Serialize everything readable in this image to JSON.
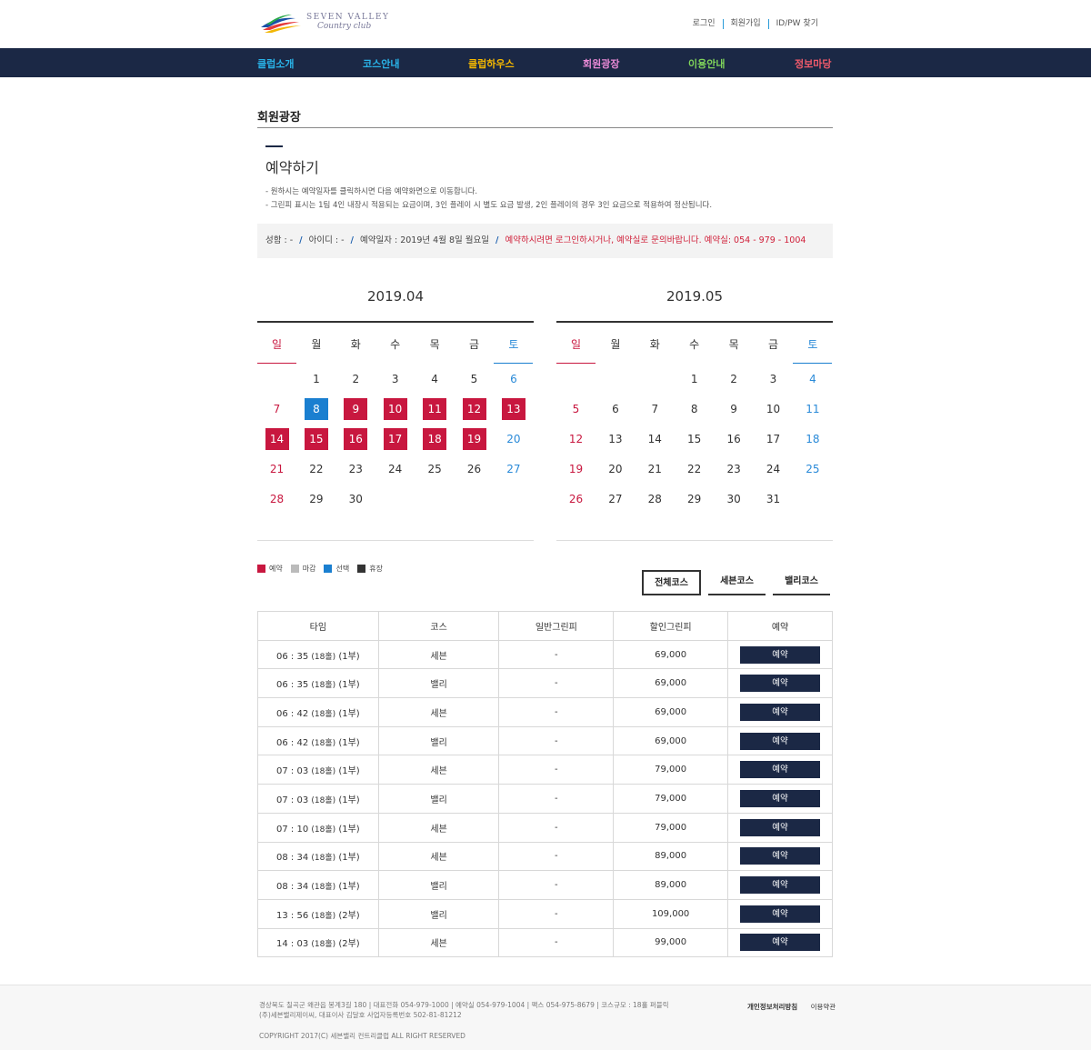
{
  "header": {
    "logo_line1": "SEVEN VALLEY",
    "logo_line2": "Country club",
    "top_links": [
      "로그인",
      "회원가입",
      "ID/PW 찾기"
    ]
  },
  "nav": [
    {
      "label": "클럽소개",
      "color": "#29b3e8"
    },
    {
      "label": "코스안내",
      "color": "#29b3e8"
    },
    {
      "label": "클럽하우스",
      "color": "#f5b800"
    },
    {
      "label": "회원광장",
      "color": "#e98ad6"
    },
    {
      "label": "이용안내",
      "color": "#7fd35a"
    },
    {
      "label": "정보마당",
      "color": "#f05a6b"
    }
  ],
  "page_title": "회원광장",
  "section_title": "예약하기",
  "notes": [
    "- 원하시는 예약일자를 클릭하시면 다음 예약화면으로 이동합니다.",
    "- 그린피 표시는 1팀 4인 내장시 적용되는 요금이며, 3인 플레이 시 별도 요금 발생, 2인 플레이의 경우 3인 요금으로 적용하여 정산됩니다."
  ],
  "info": {
    "name": "성함 : -",
    "id": "아이디 : -",
    "date": "예약일자 : 2019년 4월 8일 월요일",
    "separator": "/",
    "warning": "예약하시려면 로그인하시거나, 예약실로 문의바랍니다. 예약실: 054 - 979 - 1004"
  },
  "weekdays": [
    "일",
    "월",
    "화",
    "수",
    "목",
    "금",
    "토"
  ],
  "calendars": [
    {
      "title": "2019.04",
      "first_weekday": 1,
      "days": 30,
      "reservable": [
        9,
        10,
        11,
        12,
        13,
        14,
        15,
        16,
        17,
        18,
        19
      ],
      "selected": [
        8
      ]
    },
    {
      "title": "2019.05",
      "first_weekday": 3,
      "days": 31,
      "reservable": [],
      "selected": []
    }
  ],
  "legend": [
    {
      "label": "예약",
      "color": "#c8173f"
    },
    {
      "label": "마감",
      "color": "#bbbbbb"
    },
    {
      "label": "선택",
      "color": "#1a7fd0"
    },
    {
      "label": "휴장",
      "color": "#333333"
    }
  ],
  "course_tabs": [
    "전체코스",
    "세븐코스",
    "밸리코스"
  ],
  "table": {
    "headers": [
      "타임",
      "코스",
      "일반그린피",
      "할인그린피",
      "예약"
    ],
    "button_label": "예약",
    "rows": [
      {
        "time": "06 : 35",
        "holes": "(18홀)",
        "part": "(1부)",
        "course": "세븐",
        "normal": "-",
        "discount": "69,000"
      },
      {
        "time": "06 : 35",
        "holes": "(18홀)",
        "part": "(1부)",
        "course": "밸리",
        "normal": "-",
        "discount": "69,000"
      },
      {
        "time": "06 : 42",
        "holes": "(18홀)",
        "part": "(1부)",
        "course": "세븐",
        "normal": "-",
        "discount": "69,000"
      },
      {
        "time": "06 : 42",
        "holes": "(18홀)",
        "part": "(1부)",
        "course": "밸리",
        "normal": "-",
        "discount": "69,000"
      },
      {
        "time": "07 : 03",
        "holes": "(18홀)",
        "part": "(1부)",
        "course": "세븐",
        "normal": "-",
        "discount": "79,000"
      },
      {
        "time": "07 : 03",
        "holes": "(18홀)",
        "part": "(1부)",
        "course": "밸리",
        "normal": "-",
        "discount": "79,000"
      },
      {
        "time": "07 : 10",
        "holes": "(18홀)",
        "part": "(1부)",
        "course": "세븐",
        "normal": "-",
        "discount": "79,000"
      },
      {
        "time": "08 : 34",
        "holes": "(18홀)",
        "part": "(1부)",
        "course": "세븐",
        "normal": "-",
        "discount": "89,000"
      },
      {
        "time": "08 : 34",
        "holes": "(18홀)",
        "part": "(1부)",
        "course": "밸리",
        "normal": "-",
        "discount": "89,000"
      },
      {
        "time": "13 : 56",
        "holes": "(18홀)",
        "part": "(2부)",
        "course": "밸리",
        "normal": "-",
        "discount": "109,000"
      },
      {
        "time": "14 : 03",
        "holes": "(18홀)",
        "part": "(2부)",
        "course": "세븐",
        "normal": "-",
        "discount": "99,000"
      }
    ]
  },
  "footer": {
    "address": "경상북도 칠곡군 왜관읍 봉계3길 180 | 대표전화 054-979-1000 | 예약실 054-979-1004 | 팩스 054-975-8679 | 코스규모 : 18홀 퍼블릭",
    "company": "(주)세븐밸리제이씨, 대표이사 김달호 사업자등록번호 502-81-81212",
    "copyright": "COPYRIGHT 2017(C) 세븐밸리 컨트리클럽 ALL RIGHT RESERVED",
    "links": [
      "개인정보처리방침",
      "이용약관"
    ]
  }
}
